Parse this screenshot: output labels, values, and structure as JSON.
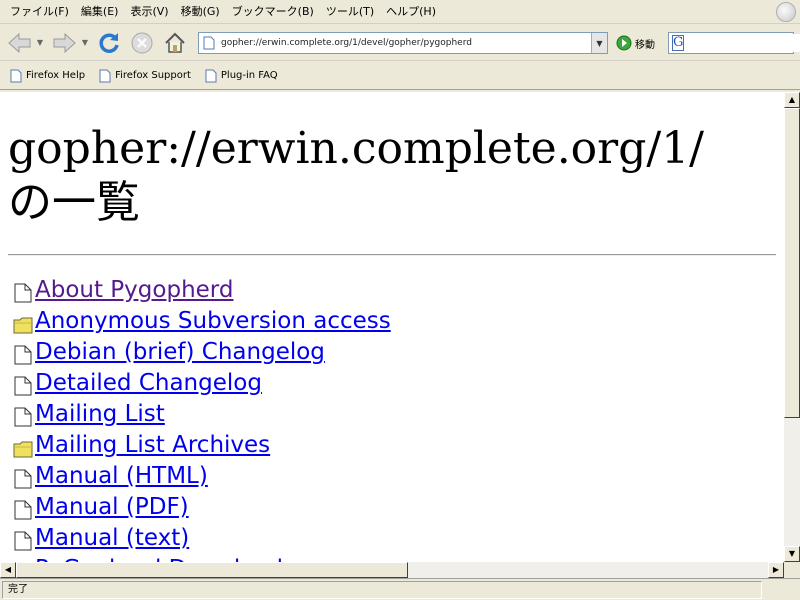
{
  "menu": [
    {
      "label": "ファイル(F)"
    },
    {
      "label": "編集(E)"
    },
    {
      "label": "表示(V)"
    },
    {
      "label": "移動(G)"
    },
    {
      "label": "ブックマーク(B)"
    },
    {
      "label": "ツール(T)"
    },
    {
      "label": "ヘルプ(H)"
    }
  ],
  "navigation": {
    "back_icon": "back-arrow-icon",
    "forward_icon": "forward-arrow-icon",
    "reload_icon": "reload-icon",
    "stop_icon": "stop-icon",
    "home_icon": "home-icon",
    "url": "gopher://erwin.complete.org/1/devel/gopher/pygopherd",
    "go_label": "移動",
    "search_engine_logo": "G",
    "search_value": ""
  },
  "bookmarks": [
    {
      "label": "Firefox Help"
    },
    {
      "label": "Firefox Support"
    },
    {
      "label": "Plug-in FAQ"
    }
  ],
  "page": {
    "heading": "gopher://erwin.complete.org/1/\nの一覧",
    "links": [
      {
        "label": "About Pygopherd",
        "icon": "document-icon",
        "visited": true
      },
      {
        "label": "Anonymous Subversion access",
        "icon": "folder-icon",
        "visited": false
      },
      {
        "label": "Debian (brief) Changelog",
        "icon": "document-icon",
        "visited": false
      },
      {
        "label": "Detailed Changelog",
        "icon": "document-icon",
        "visited": false
      },
      {
        "label": "Mailing List",
        "icon": "document-icon",
        "visited": false
      },
      {
        "label": "Mailing List Archives",
        "icon": "folder-icon",
        "visited": false
      },
      {
        "label": "Manual (HTML)",
        "icon": "document-icon",
        "visited": false
      },
      {
        "label": "Manual (PDF)",
        "icon": "document-icon",
        "visited": false
      },
      {
        "label": "Manual (text)",
        "icon": "document-icon",
        "visited": false
      },
      {
        "label": "PyGopherd Downloads",
        "icon": "folder-icon",
        "visited": false
      }
    ]
  },
  "colors": {
    "link": "#0000ee",
    "visited_link": "#551a8b",
    "chrome": "#ece9d8",
    "folder": "#f0e060"
  },
  "status": {
    "text": "完了"
  }
}
